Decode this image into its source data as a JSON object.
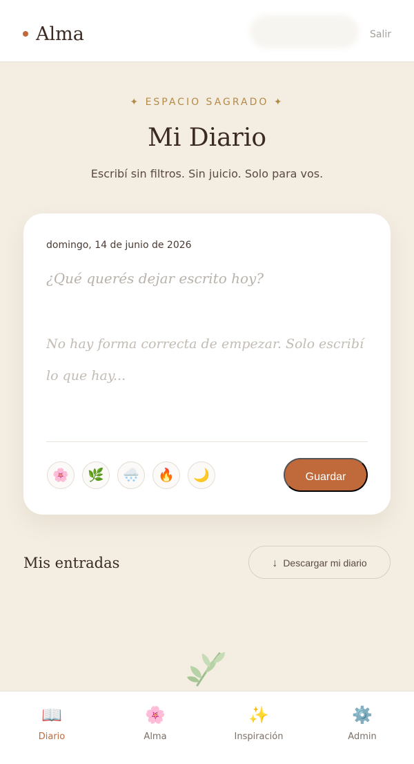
{
  "header": {
    "brand": "Alma",
    "logout_label": "Salir"
  },
  "hero": {
    "eyebrow": "✦ ESPACIO SAGRADO ✦",
    "title": "Mi Diario",
    "subtitle": "Escribí sin filtros. Sin juicio. Solo para vos."
  },
  "composer": {
    "date": "domingo, 14 de junio de 2026",
    "prompt": "¿Qué querés dejar escrito hoy?",
    "placeholder": "No hay forma correcta de empezar. Solo escribí lo que hay...",
    "value": "",
    "moods": [
      {
        "icon": "🌸",
        "name": "flower-icon"
      },
      {
        "icon": "🌿",
        "name": "herb-icon"
      },
      {
        "icon": "🌨️",
        "name": "cloud-snow-icon"
      },
      {
        "icon": "🔥",
        "name": "fire-icon"
      },
      {
        "icon": "🌙",
        "name": "moon-icon"
      }
    ],
    "save_label": "Guardar"
  },
  "entries": {
    "title": "Mis entradas",
    "download_label": "Descargar mi diario",
    "download_icon": "↓",
    "empty_icon": "leaf-icon"
  },
  "nav": [
    {
      "label": "Diario",
      "icon": "📖",
      "active": true
    },
    {
      "label": "Alma",
      "icon": "🌸",
      "active": false
    },
    {
      "label": "Inspiración",
      "icon": "✨",
      "active": false
    },
    {
      "label": "Admin",
      "icon": "⚙️",
      "active": false
    }
  ],
  "colors": {
    "background": "#f3ede2",
    "accent": "#c0693a",
    "eyebrow": "#b48a4a",
    "card": "#ffffff"
  }
}
